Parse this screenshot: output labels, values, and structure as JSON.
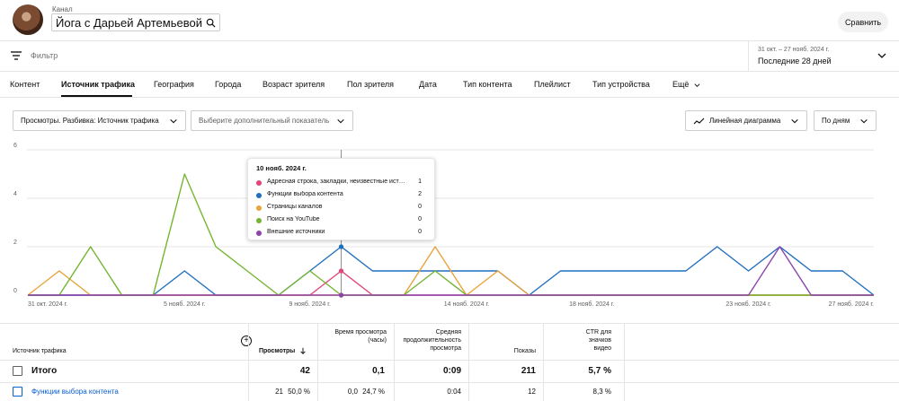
{
  "header": {
    "channel_caption": "Канал",
    "channel_name": "Йога с Дарьей Артемьевой",
    "compare_label": "Сравнить"
  },
  "filter": {
    "placeholder": "Фильтр"
  },
  "date": {
    "range": "31 окт. – 27 нояб. 2024 г.",
    "period": "Последние 28 дней"
  },
  "tabs": [
    {
      "label": "Контент"
    },
    {
      "label": "Источник трафика",
      "active": true
    },
    {
      "label": "География"
    },
    {
      "label": "Города"
    },
    {
      "label": "Возраст зрителя"
    },
    {
      "label": "Пол зрителя"
    },
    {
      "label": "Дата"
    },
    {
      "label": "Тип контента"
    },
    {
      "label": "Плейлист"
    },
    {
      "label": "Тип устройства"
    },
    {
      "label": "Ещё"
    }
  ],
  "controls": {
    "primary": "Просмотры. Разбивка: Источник трафика",
    "secondary": "Выберите дополнительный показатель",
    "chart_type": "Линейная диаграмма",
    "granularity": "По дням"
  },
  "chart_data": {
    "type": "line",
    "y_ticks": [
      "0",
      "2",
      "4",
      "6"
    ],
    "ylim": [
      0,
      6
    ],
    "x_tick_labels": [
      {
        "index": 0,
        "label": "31 окт. 2024 г."
      },
      {
        "index": 5,
        "label": "5 нояб. 2024 г."
      },
      {
        "index": 9,
        "label": "9 нояб. 2024 г."
      },
      {
        "index": 14,
        "label": "14 нояб. 2024 г."
      },
      {
        "index": 18,
        "label": "18 нояб. 2024 г."
      },
      {
        "index": 23,
        "label": "23 нояб. 2024 г."
      },
      {
        "index": 27,
        "label": "27 нояб. 2024 г."
      }
    ],
    "highlight_index": 10,
    "grid": true,
    "series": [
      {
        "color": "#e0457b",
        "values": [
          0,
          0,
          0,
          0,
          0,
          0,
          0,
          0,
          0,
          0,
          1,
          0,
          0,
          0,
          0,
          0,
          0,
          0,
          0,
          0,
          0,
          0,
          0,
          0,
          0,
          0,
          0,
          0
        ]
      },
      {
        "color": "#1f6fbf",
        "values": [
          0,
          0,
          0,
          0,
          0,
          1,
          0,
          0,
          0,
          1,
          2,
          1,
          1,
          1,
          1,
          1,
          0,
          1,
          1,
          1,
          1,
          1,
          2,
          1,
          2,
          1,
          1,
          0
        ]
      },
      {
        "color": "#e8a33c",
        "values": [
          0,
          1,
          0,
          0,
          0,
          0,
          0,
          0,
          0,
          0,
          0,
          0,
          0,
          2,
          0,
          1,
          0,
          0,
          0,
          0,
          0,
          0,
          0,
          0,
          0,
          0,
          0,
          0
        ]
      },
      {
        "color": "#74b532",
        "values": [
          0,
          0,
          2,
          0,
          0,
          5,
          2,
          1,
          0,
          1,
          0,
          0,
          0,
          1,
          0,
          0,
          0,
          0,
          0,
          0,
          0,
          0,
          0,
          0,
          0,
          0,
          0,
          0
        ]
      },
      {
        "color": "#8e44ad",
        "values": [
          0,
          0,
          0,
          0,
          0,
          0,
          0,
          0,
          0,
          0,
          0,
          0,
          0,
          0,
          0,
          0,
          0,
          0,
          0,
          0,
          0,
          0,
          0,
          0,
          2,
          0,
          0,
          0
        ]
      }
    ]
  },
  "tooltip": {
    "date": "10 нояб. 2024 г.",
    "rows": [
      {
        "label": "Адресная строка, закладки, неизвестные источники",
        "value": "1",
        "color": "#e0457b"
      },
      {
        "label": "Функции выбора контента",
        "value": "2",
        "color": "#1f6fbf"
      },
      {
        "label": "Страницы каналов",
        "value": "0",
        "color": "#e8a33c"
      },
      {
        "label": "Поиск на YouTube",
        "value": "0",
        "color": "#74b532"
      },
      {
        "label": "Внешние источники",
        "value": "0",
        "color": "#8e44ad"
      }
    ]
  },
  "table": {
    "headers": {
      "source": "Источник трафика",
      "views": "Просмотры",
      "watch_time": "Время просмотра (часы)",
      "avg_duration": "Средняя продолжительность просмотра",
      "impressions": "Показы",
      "ctr": "CTR для значков видео"
    },
    "total": {
      "label": "Итого",
      "views": "42",
      "watch_time": "0,1",
      "avg_duration": "0:09",
      "impressions": "211",
      "ctr": "5,7 %"
    },
    "rows": [
      {
        "source": "Функции выбора контента",
        "views": "21",
        "views_pct": "50,0 %",
        "watch_time": "0,0",
        "watch_pct": "24,7 %",
        "avg_duration": "0:04",
        "impressions": "12",
        "ctr": "8,3 %"
      }
    ]
  }
}
